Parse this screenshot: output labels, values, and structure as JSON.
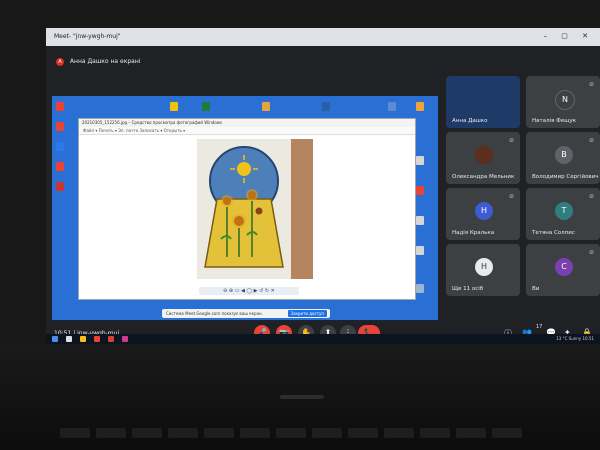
{
  "browser": {
    "tab_title": "Meet- \"jnw-ywgh-muj\"",
    "controls": "– ▢ ✕"
  },
  "presenter": {
    "badge": "A",
    "label": "Анна Дашко на екрані"
  },
  "shared_screen": {
    "viewer_title": "20210305_152256.jpg – Средство просмотра фотографий Windows",
    "menu": "Файл ▾   Печать ▾   Эл. почта   Записать ▾   Открыть ▾",
    "toolbar": "⊖  ⊕  ▭  ◀  ◯  ▶  ↺  ↻  ✕",
    "notice_text": "Система Meet.Google.com показує ваш екран.",
    "notice_button": "Закрити доступ"
  },
  "participants": [
    {
      "name": "Анна Дашко",
      "avatar_letter": "",
      "color": "#1e3b68",
      "muted": false
    },
    {
      "name": "Наталія Фещук",
      "avatar_letter": "N",
      "color": "#3c4043",
      "muted": true
    },
    {
      "name": "Олександра Мельник",
      "avatar_letter": "",
      "color": "#5b2e1d",
      "muted": true
    },
    {
      "name": "Володимир Сергійович",
      "avatar_letter": "B",
      "color": "#3c4043",
      "muted": true
    },
    {
      "name": "Надія Кралька",
      "avatar_letter": "H",
      "color": "#3f5bd1",
      "muted": true
    },
    {
      "name": "Тетяна Солпис",
      "avatar_letter": "T",
      "color": "#2f7d7d",
      "muted": true
    },
    {
      "name": "Ще 11 осіб",
      "avatar_letter": "H",
      "color": "#e8eaed",
      "muted": false
    },
    {
      "name": "Ви",
      "avatar_letter": "C",
      "color": "#7b3fb0",
      "muted": true
    }
  ],
  "meeting": {
    "time": "10:51",
    "code": "jnw-ywgh-muj",
    "people_count": "17"
  },
  "controls": {
    "mic": "🎤",
    "camera": "📷",
    "hand": "✋",
    "present": "⬆",
    "more": "⋮",
    "hangup": "📞"
  },
  "right_icons": {
    "info": "ⓘ",
    "people": "👥",
    "chat": "💬",
    "activities": "✦",
    "lock": "🔒"
  },
  "windows_tray": {
    "weather": "13 °C Sunny",
    "time": "10:51"
  }
}
